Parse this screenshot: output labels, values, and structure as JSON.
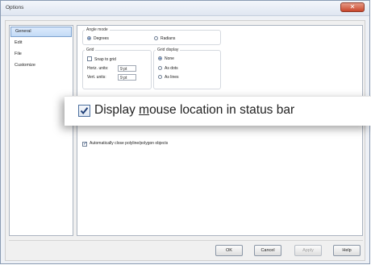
{
  "window": {
    "title": "Options",
    "close_glyph": "✕"
  },
  "sidebar": {
    "items": [
      {
        "label": "General"
      },
      {
        "label": "Edit"
      },
      {
        "label": "File"
      },
      {
        "label": "Customize"
      }
    ]
  },
  "angle_mode": {
    "legend": "Angle mode",
    "degrees": "Degrees",
    "radians": "Radians",
    "selected": "Degrees"
  },
  "grid": {
    "legend": "Grid",
    "snap_label": "Snap to grid",
    "snap_checked": false,
    "horiz_label": "Horiz. units:",
    "horiz_value": "9 pt",
    "vert_label": "Vert. units:",
    "vert_value": "9 pt"
  },
  "grid_display": {
    "legend": "Grid display",
    "none": "None",
    "as_dots": "As dots",
    "as_lines": "As lines",
    "selected": "None"
  },
  "display_mouse": {
    "label_pre": "Display ",
    "label_u": "m",
    "label_post": "ouse location in status bar",
    "checked": true
  },
  "auto_close": {
    "label": "Automatically close polyline/polygon objects",
    "checked": true
  },
  "buttons": {
    "ok": "OK",
    "cancel": "Cancel",
    "apply": "Apply",
    "help": "Help"
  },
  "colors": {
    "accent": "#1c4f9c",
    "selected_bg": "#c3dbf6",
    "close_button": "#c9462c"
  }
}
